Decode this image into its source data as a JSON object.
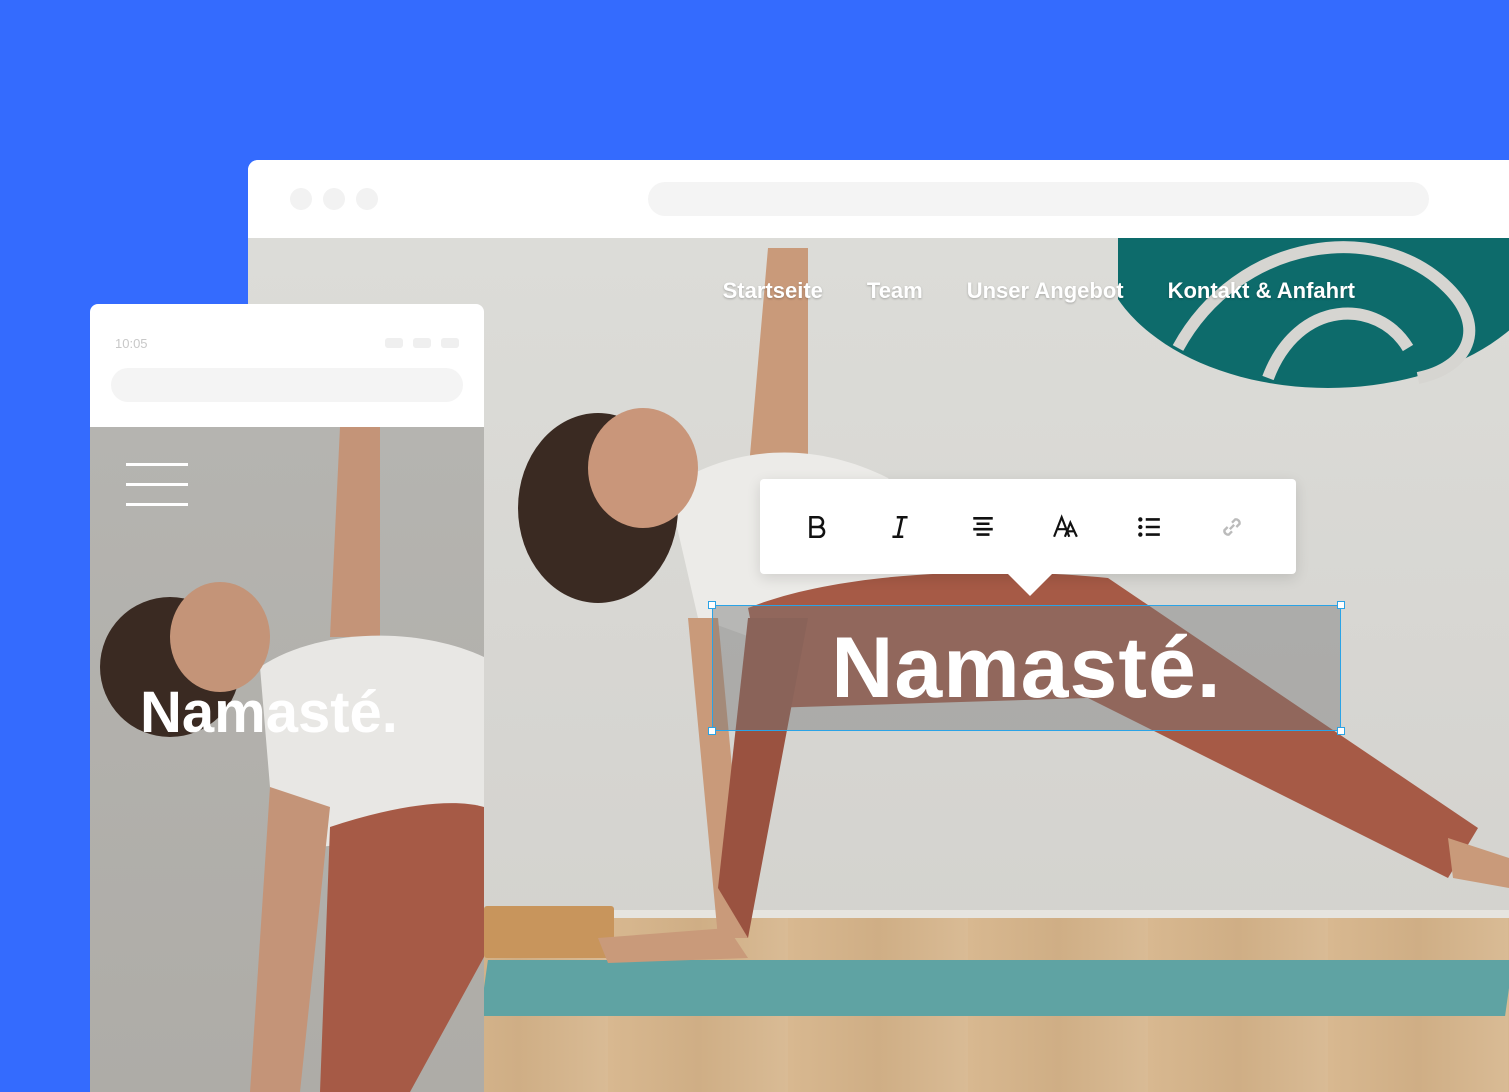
{
  "desktop": {
    "nav": {
      "items": [
        "Startseite",
        "Team",
        "Unser Angebot",
        "Kontakt & Anfahrt"
      ]
    },
    "toolbar": {
      "buttons": [
        "bold-icon",
        "italic-icon",
        "align-center-icon",
        "font-size-icon",
        "bulleted-list-icon",
        "link-icon"
      ]
    },
    "headline": "Namasté."
  },
  "mobile": {
    "status_time": "10:05",
    "headline": "Namasté."
  },
  "colors": {
    "background": "#346bfe",
    "selection_border": "#2aa3e6",
    "text_on_image": "#ffffff",
    "wall_art": "#0d6b6b",
    "mat": "#5fa3a3"
  }
}
